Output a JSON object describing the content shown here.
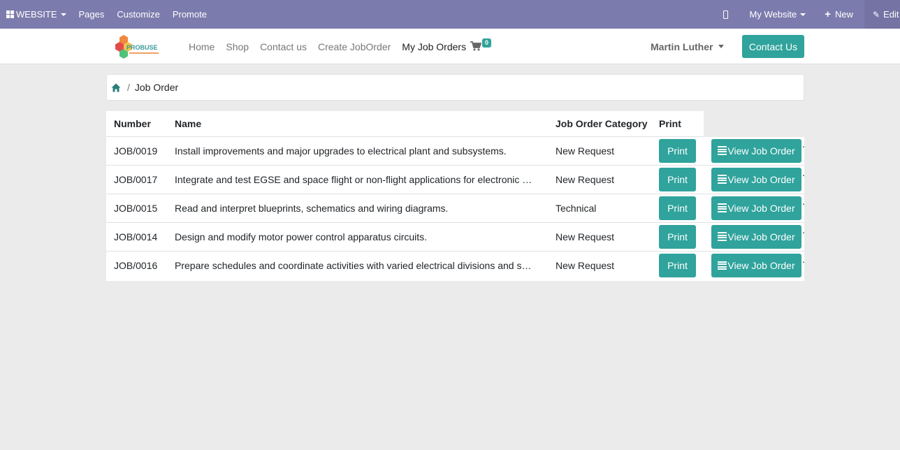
{
  "admin_bar": {
    "website_label": "WEBSITE",
    "pages_label": "Pages",
    "customize_label": "Customize",
    "promote_label": "Promote",
    "my_website_label": "My Website",
    "new_label": "New",
    "edit_label": "Edit",
    "color": "#7c7bad"
  },
  "header": {
    "logo_text": "PROBUSE",
    "nav": {
      "home": "Home",
      "shop": "Shop",
      "contact_us": "Contact us",
      "create_job_order": "Create JobOrder",
      "my_job_orders": "My Job Orders"
    },
    "cart_count": "0",
    "user_name": "Martin Luther",
    "contact_button": "Contact Us",
    "accent_color": "#2fa39c"
  },
  "breadcrumb": {
    "home_icon": "home-icon",
    "separator": "/",
    "current": "Job Order"
  },
  "table": {
    "headers": {
      "number": "Number",
      "name": "Name",
      "category": "Job Order Category",
      "print": "Print"
    },
    "print_label": "Print",
    "view_label": "View Job Order",
    "rows": [
      {
        "number": "JOB/0019",
        "name": "Install improvements and major upgrades to electrical plant and subsystems.",
        "category": "New Request"
      },
      {
        "number": "JOB/0017",
        "name": "Integrate and test EGSE and space flight or non-flight applications for electronic …",
        "category": "New Request"
      },
      {
        "number": "JOB/0015",
        "name": "Read and interpret blueprints, schematics and wiring diagrams.",
        "category": "Technical"
      },
      {
        "number": "JOB/0014",
        "name": "Design and modify motor power control apparatus circuits.",
        "category": "New Request"
      },
      {
        "number": "JOB/0016",
        "name": "Prepare schedules and coordinate activities with varied electrical divisions and s…",
        "category": "New Request"
      }
    ]
  }
}
